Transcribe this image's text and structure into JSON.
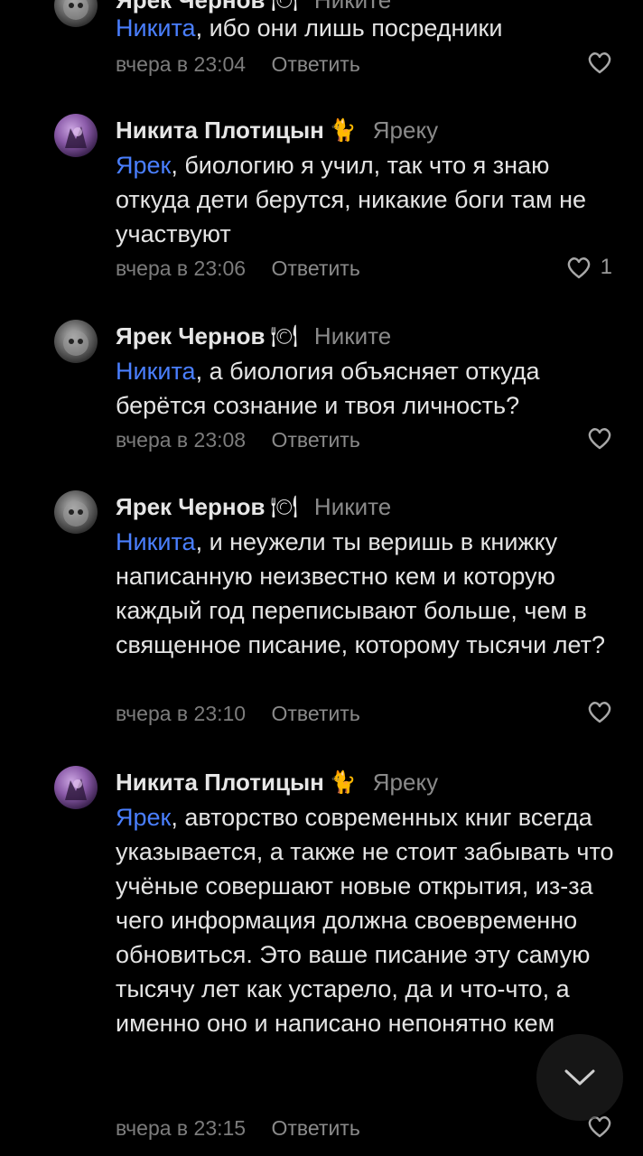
{
  "comments": [
    {
      "author": "Ярек Чернов",
      "emoji": "🍽",
      "reply_to": "Никите",
      "mention": "Никита",
      "text": ", ибо они лишь посредники",
      "time": "вчера в 23:04",
      "reply_label": "Ответить",
      "likes": ""
    },
    {
      "author": "Никита Плотицын",
      "emoji": "🐈",
      "reply_to": "Яреку",
      "mention": "Ярек",
      "text": ", биологию я учил, так что я знаю откуда дети берутся, никакие боги там не участвуют",
      "time": "вчера в 23:06",
      "reply_label": "Ответить",
      "likes": "1"
    },
    {
      "author": "Ярек Чернов",
      "emoji": "🍽",
      "reply_to": "Никите",
      "mention": "Никита",
      "text": ", а биология объясняет откуда берётся сознание и твоя личность?",
      "time": "вчера в 23:08",
      "reply_label": "Ответить",
      "likes": ""
    },
    {
      "author": "Ярек Чернов",
      "emoji": "🍽",
      "reply_to": "Никите",
      "mention": "Никита",
      "text": ", и неужели ты веришь в книжку написанную неизвестно кем и которую каждый год переписывают больше, чем в священное писание, которому тысячи лет?",
      "time": "вчера в 23:10",
      "reply_label": "Ответить",
      "likes": ""
    },
    {
      "author": "Никита Плотицын",
      "emoji": "🐈",
      "reply_to": "Яреку",
      "mention": "Ярек",
      "text": ", авторство современных книг всегда указывается, а также не стоит забывать что учёные совершают новые открытия, из-за чего информация должна своевременно обновиться. Это ваше писание эту самую тысячу лет как устарело, да и что-что, а именно оно и написано непонятно кем",
      "time": "вчера в 23:15",
      "reply_label": "Ответить",
      "likes": ""
    }
  ],
  "colors": {
    "mention": "#4a7fff",
    "background": "#000000"
  }
}
